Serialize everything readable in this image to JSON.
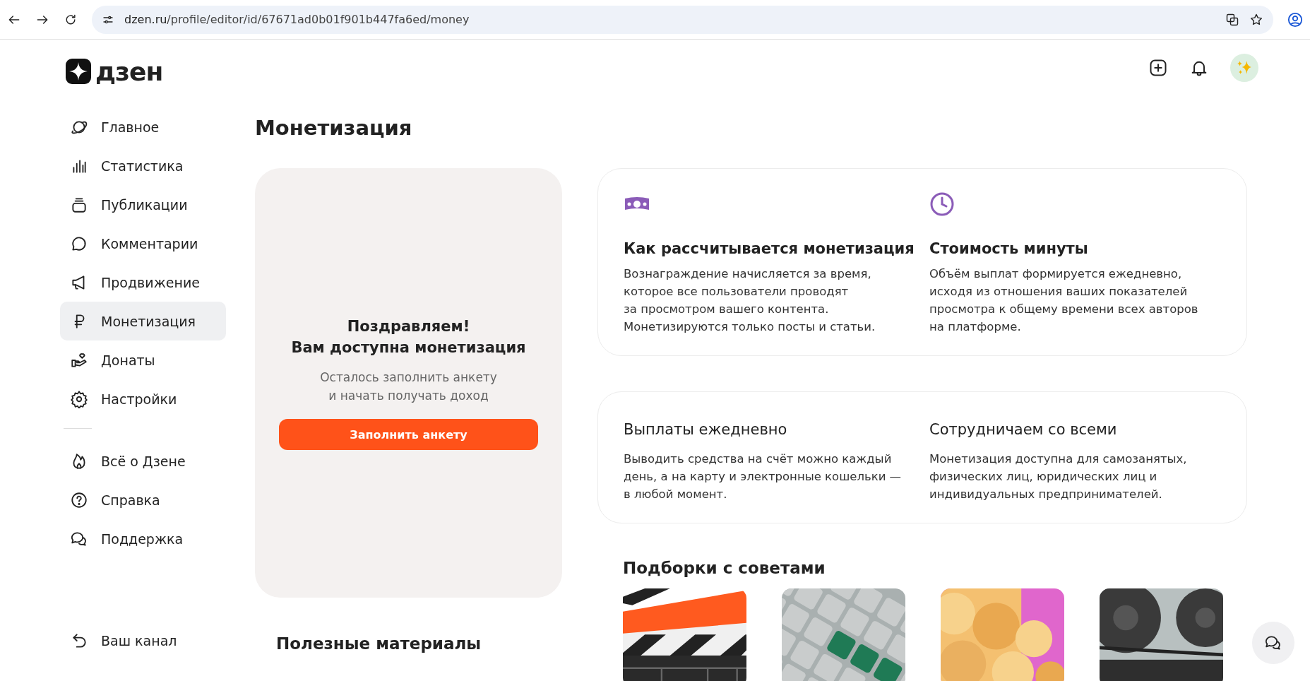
{
  "browser": {
    "url_host": "dzen.ru",
    "url_path": "/profile/editor/id/67671ad0b01f901b447fa6ed/money"
  },
  "logo": "дзен",
  "sidebar": {
    "items": [
      {
        "label": "Главное",
        "kind": "planet",
        "selected": false
      },
      {
        "label": "Статистика",
        "kind": "bars",
        "selected": false
      },
      {
        "label": "Публикации",
        "kind": "stack",
        "selected": false
      },
      {
        "label": "Комментарии",
        "kind": "bubble",
        "selected": false
      },
      {
        "label": "Продвижение",
        "kind": "megaphone",
        "selected": false
      },
      {
        "label": "Монетизация",
        "kind": "ruble",
        "selected": true
      },
      {
        "label": "Донаты",
        "kind": "hand",
        "selected": false
      },
      {
        "label": "Настройки",
        "kind": "gear",
        "selected": false
      }
    ],
    "extra_items": [
      {
        "label": "Всё о Дзене",
        "kind": "flame"
      },
      {
        "label": "Справка",
        "kind": "help"
      },
      {
        "label": "Поддержка",
        "kind": "chat"
      }
    ],
    "channel_link": "Ваш канал"
  },
  "page_title": "Монетизация",
  "promo": {
    "title_line1": "Поздравляем!",
    "title_line2": "Вам доступна монетизация",
    "text_line1": "Осталось заполнить анкету",
    "text_line2": "и начать получать доход",
    "button": "Заполнить анкету"
  },
  "useful_title": "Полезные материалы",
  "info_cards": [
    {
      "items": [
        {
          "kind": "money",
          "title": "Как рассчитывается монетизация",
          "lines": [
            "Вознаграждение начисляется за время,",
            "которое все пользователи проводят",
            "за просмотром вашего контента.",
            "Монетизируются только посты и статьи."
          ]
        },
        {
          "kind": "clock",
          "title": "Стоимость минуты",
          "lines": [
            "Объём выплат формируется ежедневно,",
            "исходя из отношения ваших показателей",
            "просмотра к общему времени всех авторов",
            "на платформе."
          ]
        }
      ]
    },
    {
      "items": [
        {
          "kind": "plain",
          "title": "Выплаты ежедневно",
          "lines": [
            "Выводить средства на счёт можно каждый",
            "день, а на карту и электронные кошельки —",
            "в любой момент."
          ]
        },
        {
          "kind": "plain",
          "title": "Сотрудничаем со всеми",
          "lines": [
            "Монетизация доступна для самозанятых,",
            "физических лиц, юридических лиц и",
            "индивидуальных предпринимателей."
          ]
        }
      ]
    }
  ],
  "tips": {
    "title": "Подборки с советами",
    "items": [
      {
        "kind": "clapper"
      },
      {
        "kind": "keyboard"
      },
      {
        "kind": "popcorn"
      },
      {
        "kind": "reels"
      }
    ]
  }
}
